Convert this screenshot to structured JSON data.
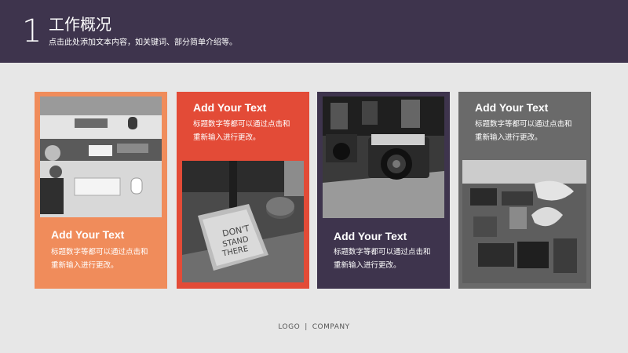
{
  "header": {
    "number": "1",
    "title": "工作概况",
    "subtitle": "点击此处添加文本内容，如关键词、部分简单介绍等。"
  },
  "cards": [
    {
      "title": "Add Your Text",
      "desc": "标题数字等都可以通过点击和重新输入进行更改。",
      "color": "#f08c5b",
      "image": "desk-workspace-photo"
    },
    {
      "title": "Add Your Text",
      "desc": "标题数字等都可以通过点击和重新输入进行更改。",
      "color": "#e34b37",
      "image": "notebook-photo"
    },
    {
      "title": "Add Your Text",
      "desc": "标题数字等都可以通过点击和重新输入进行更改。",
      "color": "#3e344d",
      "image": "camera-photo"
    },
    {
      "title": "Add Your Text",
      "desc": "标题数字等都可以通过点击和重新输入进行更改。",
      "color": "#6a6a6a",
      "image": "stamps-photo"
    }
  ],
  "footer": {
    "logo": "LOGO",
    "separator": "|",
    "company": "COMPANY"
  }
}
